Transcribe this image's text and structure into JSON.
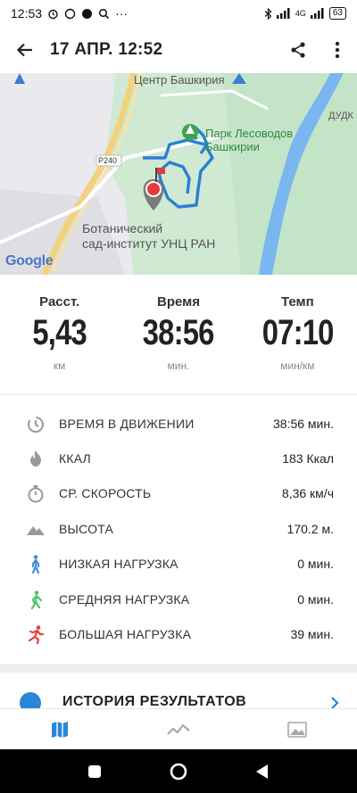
{
  "status_bar": {
    "time": "12:53",
    "battery": "63",
    "network": "4G"
  },
  "header": {
    "title": "17 АПР. 12:52"
  },
  "map": {
    "labels": {
      "center": "Центр Башкирия",
      "park_line1": "Парк Лесоводов",
      "park_line2": "Башкирии",
      "road": "Р240",
      "garden_line1": "Ботанический",
      "garden_line2": "сад-институт УНЦ РАН",
      "dudk": "ДУДК"
    },
    "attribution": "Google",
    "route_color": "#2a7fd4"
  },
  "summary": {
    "distance": {
      "label": "Расст.",
      "value": "5,43",
      "unit": "км"
    },
    "time": {
      "label": "Время",
      "value": "38:56",
      "unit": "мин."
    },
    "pace": {
      "label": "Темп",
      "value": "07:10",
      "unit": "мин/км"
    }
  },
  "details": [
    {
      "icon": "moving-time-icon",
      "label": "ВРЕМЯ В ДВИЖЕНИИ",
      "value": "38:56 мин."
    },
    {
      "icon": "flame-icon",
      "label": "ККАЛ",
      "value": "183 Ккал"
    },
    {
      "icon": "stopwatch-icon",
      "label": "СР. СКОРОСТЬ",
      "value": "8,36 км/ч"
    },
    {
      "icon": "mountain-icon",
      "label": "ВЫСОТА",
      "value": "170.2 м."
    },
    {
      "icon": "walker-icon",
      "label": "НИЗКАЯ НАГРУЗКА",
      "value": "0 мин."
    },
    {
      "icon": "walker-green-icon",
      "label": "СРЕДНЯЯ НАГРУЗКА",
      "value": "0 мин."
    },
    {
      "icon": "runner-icon",
      "label": "БОЛЬШАЯ НАГРУЗКА",
      "value": "39 мин."
    }
  ],
  "history": {
    "title": "ИСТОРИЯ РЕЗУЛЬТАТОВ"
  },
  "colors": {
    "accent": "#2a86d6",
    "low": "#3f8fd8",
    "medium": "#4cc46a",
    "high": "#e0433f"
  }
}
